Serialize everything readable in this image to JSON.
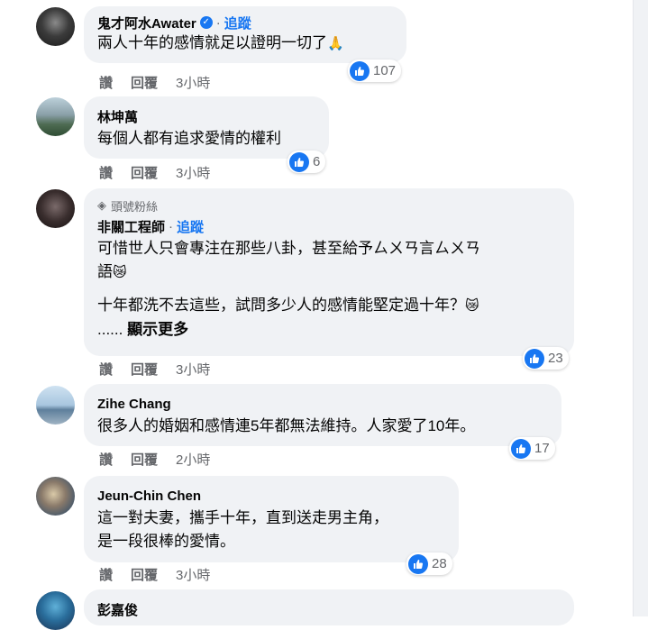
{
  "comments": [
    {
      "name": "鬼才阿水Awater",
      "verified": true,
      "follow": "追蹤",
      "lines": [
        "兩人十年的感情就足以證明一切了"
      ],
      "emoji_end": "🙏",
      "likes": "107",
      "actions": {
        "like": "讚",
        "reply": "回覆",
        "time": "3小時"
      }
    },
    {
      "name": "林坤萬",
      "lines": [
        "每個人都有追求愛情的權利"
      ],
      "likes": "6",
      "actions": {
        "like": "讚",
        "reply": "回覆",
        "time": "3小時"
      }
    },
    {
      "badge": "頭號粉絲",
      "name": "非關工程師",
      "follow": "追蹤",
      "lines": [
        "可惜世人只會專注在那些八卦，甚至給予ㄙㄨㄢ言ㄙㄨㄢ",
        "語"
      ],
      "emoji_line2": "😿",
      "lines2": [
        "十年都洗不去這些，試問多少人的感情能堅定過十年？"
      ],
      "emoji_line3": "😿",
      "more_prefix": "......",
      "more": "顯示更多",
      "likes": "23",
      "actions": {
        "like": "讚",
        "reply": "回覆",
        "time": "3小時"
      }
    },
    {
      "name": "Zihe Chang",
      "lines": [
        "很多人的婚姻和感情連5年都無法維持。人家愛了10年。"
      ],
      "likes": "17",
      "actions": {
        "like": "讚",
        "reply": "回覆",
        "time": "2小時"
      }
    },
    {
      "name": "Jeun-Chin Chen",
      "lines": [
        "這一對夫妻，攜手十年，直到送走男主角，",
        "是一段很棒的愛情。"
      ],
      "likes": "28",
      "actions": {
        "like": "讚",
        "reply": "回覆",
        "time": "3小時"
      }
    },
    {
      "name": "彭嘉俊"
    }
  ],
  "colors": {
    "accent": "#1877f2",
    "bubble": "#f0f2f5",
    "muted": "#65676b"
  },
  "icons": {
    "verified": "verified-badge-icon",
    "like": "thumbs-up-icon",
    "fan": "diamond-icon"
  }
}
